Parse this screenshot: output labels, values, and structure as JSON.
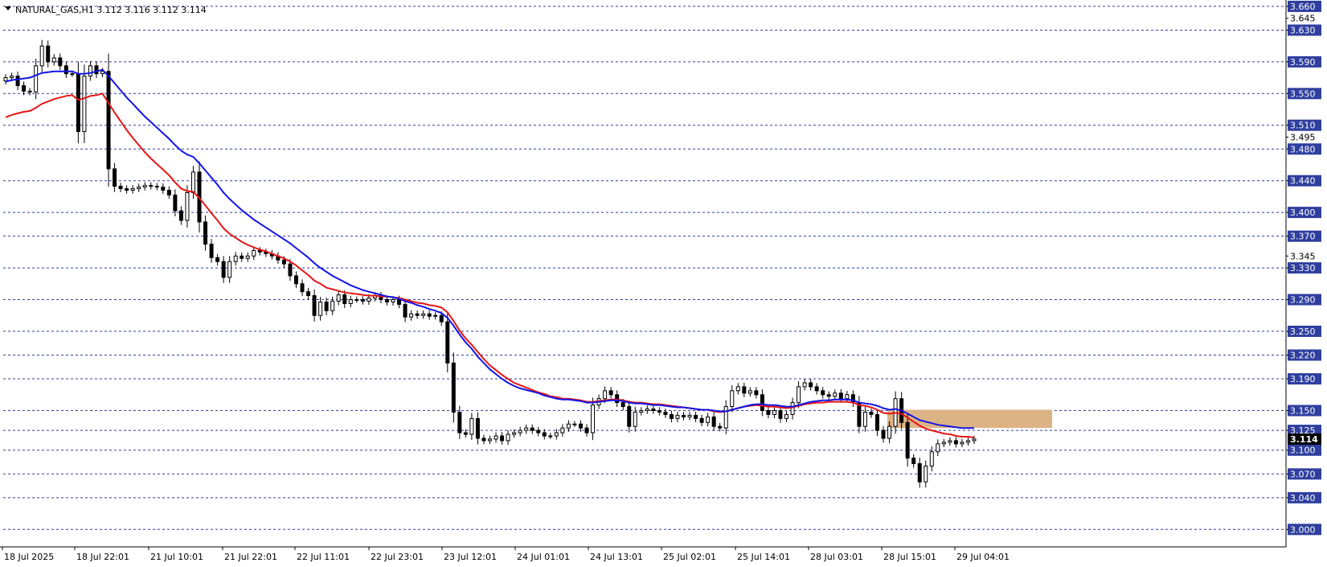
{
  "chart_data": {
    "type": "candlestick",
    "title": "NATURAL_GAS,H1  3.112 3.116 3.112 3.114",
    "y_range": [
      2.98,
      3.666
    ],
    "y_ticks": [
      "3.660",
      "3.645",
      "3.630",
      "3.590",
      "3.550",
      "3.510",
      "3.495",
      "3.480",
      "3.440",
      "3.400",
      "3.370",
      "3.345",
      "3.330",
      "3.290",
      "3.250",
      "3.220",
      "3.190",
      "3.150",
      "3.125",
      "3.100",
      "3.070",
      "3.040",
      "3.000"
    ],
    "level_lines": [
      3.66,
      3.63,
      3.59,
      3.55,
      3.51,
      3.48,
      3.44,
      3.4,
      3.37,
      3.33,
      3.29,
      3.25,
      3.22,
      3.19,
      3.15,
      3.125,
      3.1,
      3.07,
      3.04,
      3.0
    ],
    "current_price": "3.114",
    "x_ticks": [
      "18 Jul 2025",
      "18 Jul 22:01",
      "21 Jul 10:01",
      "21 Jul 22:01",
      "22 Jul 11:01",
      "22 Jul 23:01",
      "23 Jul 12:01",
      "24 Jul 01:01",
      "24 Jul 13:01",
      "25 Jul 02:01",
      "25 Jul 14:01",
      "28 Jul 03:01",
      "28 Jul 15:01",
      "29 Jul 04:01"
    ],
    "zone": {
      "from": 3.128,
      "to": 3.151,
      "color": "#dcb385"
    },
    "colors": {
      "grid": "#2f3f9f",
      "label_bg": "#2f3f9f",
      "ma_fast": "#1515e6",
      "ma_slow": "#e61515",
      "candle": "#000000",
      "bull_fill": "#ffffff",
      "bear_fill": "#000000"
    },
    "close": [
      3.57,
      3.572,
      3.56,
      3.553,
      3.552,
      3.585,
      3.61,
      3.59,
      3.595,
      3.585,
      3.575,
      3.575,
      3.502,
      3.572,
      3.585,
      3.575,
      3.578,
      3.455,
      3.433,
      3.43,
      3.428,
      3.43,
      3.432,
      3.434,
      3.433,
      3.432,
      3.428,
      3.422,
      3.402,
      3.39,
      3.425,
      3.451,
      3.388,
      3.36,
      3.343,
      3.338,
      3.318,
      3.338,
      3.345,
      3.342,
      3.345,
      3.352,
      3.35,
      3.348,
      3.345,
      3.34,
      3.335,
      3.32,
      3.31,
      3.3,
      3.295,
      3.27,
      3.287,
      3.276,
      3.288,
      3.296,
      3.285,
      3.29,
      3.29,
      3.288,
      3.292,
      3.295,
      3.29,
      3.287,
      3.29,
      3.284,
      3.268,
      3.272,
      3.27,
      3.272,
      3.269,
      3.27,
      3.262,
      3.21,
      3.148,
      3.122,
      3.12,
      3.14,
      3.115,
      3.112,
      3.114,
      3.118,
      3.112,
      3.12,
      3.122,
      3.125,
      3.128,
      3.125,
      3.122,
      3.118,
      3.118,
      3.122,
      3.128,
      3.133,
      3.133,
      3.128,
      3.122,
      3.157,
      3.165,
      3.175,
      3.17,
      3.16,
      3.155,
      3.13,
      3.148,
      3.15,
      3.152,
      3.15,
      3.148,
      3.145,
      3.14,
      3.144,
      3.142,
      3.144,
      3.14,
      3.135,
      3.142,
      3.13,
      3.128,
      3.155,
      3.175,
      3.18,
      3.172,
      3.175,
      3.17,
      3.15,
      3.145,
      3.15,
      3.14,
      3.145,
      3.16,
      3.18,
      3.185,
      3.18,
      3.175,
      3.17,
      3.168,
      3.172,
      3.165,
      3.17,
      3.16,
      3.13,
      3.148,
      3.145,
      3.125,
      3.115,
      3.13,
      3.165,
      3.135,
      3.09,
      3.083,
      3.06,
      3.08,
      3.098,
      3.108,
      3.11,
      3.112,
      3.108,
      3.11,
      3.112,
      3.114
    ],
    "ma_fast": [
      3.565,
      3.567,
      3.568,
      3.569,
      3.57,
      3.573,
      3.576,
      3.577,
      3.578,
      3.578,
      3.578,
      3.578,
      3.575,
      3.575,
      3.576,
      3.578,
      3.58,
      3.572,
      3.563,
      3.554,
      3.545,
      3.537,
      3.529,
      3.521,
      3.514,
      3.507,
      3.5,
      3.493,
      3.485,
      3.478,
      3.473,
      3.47,
      3.462,
      3.453,
      3.444,
      3.435,
      3.425,
      3.417,
      3.41,
      3.403,
      3.397,
      3.391,
      3.386,
      3.381,
      3.376,
      3.371,
      3.366,
      3.361,
      3.355,
      3.349,
      3.343,
      3.336,
      3.33,
      3.325,
      3.32,
      3.316,
      3.312,
      3.308,
      3.305,
      3.302,
      3.3,
      3.298,
      3.296,
      3.294,
      3.293,
      3.291,
      3.288,
      3.286,
      3.283,
      3.281,
      3.278,
      3.276,
      3.273,
      3.267,
      3.257,
      3.246,
      3.236,
      3.228,
      3.218,
      3.21,
      3.202,
      3.196,
      3.19,
      3.185,
      3.181,
      3.178,
      3.176,
      3.174,
      3.172,
      3.169,
      3.167,
      3.165,
      3.164,
      3.164,
      3.163,
      3.162,
      3.16,
      3.16,
      3.161,
      3.162,
      3.163,
      3.163,
      3.162,
      3.16,
      3.159,
      3.159,
      3.158,
      3.157,
      3.157,
      3.156,
      3.155,
      3.154,
      3.154,
      3.153,
      3.152,
      3.151,
      3.151,
      3.15,
      3.149,
      3.149,
      3.151,
      3.153,
      3.155,
      3.157,
      3.158,
      3.158,
      3.157,
      3.157,
      3.156,
      3.155,
      3.155,
      3.157,
      3.159,
      3.161,
      3.162,
      3.163,
      3.163,
      3.164,
      3.164,
      3.164,
      3.163,
      3.16,
      3.159,
      3.158,
      3.156,
      3.153,
      3.151,
      3.152,
      3.15,
      3.146,
      3.142,
      3.138,
      3.136,
      3.134,
      3.132,
      3.131,
      3.13,
      3.129,
      3.128,
      3.128,
      3.128
    ],
    "ma_slow": [
      3.52,
      3.523,
      3.525,
      3.527,
      3.528,
      3.532,
      3.537,
      3.54,
      3.543,
      3.545,
      3.547,
      3.548,
      3.542,
      3.544,
      3.547,
      3.548,
      3.55,
      3.538,
      3.526,
      3.515,
      3.504,
      3.494,
      3.485,
      3.476,
      3.468,
      3.461,
      3.454,
      3.447,
      3.438,
      3.43,
      3.427,
      3.426,
      3.418,
      3.409,
      3.399,
      3.39,
      3.38,
      3.373,
      3.368,
      3.363,
      3.359,
      3.356,
      3.353,
      3.351,
      3.348,
      3.345,
      3.342,
      3.338,
      3.333,
      3.327,
      3.321,
      3.314,
      3.31,
      3.305,
      3.303,
      3.301,
      3.299,
      3.298,
      3.297,
      3.296,
      3.295,
      3.295,
      3.294,
      3.294,
      3.293,
      3.292,
      3.29,
      3.288,
      3.286,
      3.285,
      3.283,
      3.282,
      3.28,
      3.274,
      3.263,
      3.251,
      3.241,
      3.233,
      3.224,
      3.215,
      3.207,
      3.201,
      3.195,
      3.19,
      3.185,
      3.182,
      3.179,
      3.176,
      3.173,
      3.171,
      3.168,
      3.167,
      3.165,
      3.165,
      3.164,
      3.163,
      3.161,
      3.161,
      3.162,
      3.163,
      3.164,
      3.164,
      3.163,
      3.161,
      3.16,
      3.16,
      3.159,
      3.158,
      3.158,
      3.157,
      3.156,
      3.155,
      3.154,
      3.153,
      3.152,
      3.151,
      3.151,
      3.149,
      3.148,
      3.149,
      3.151,
      3.153,
      3.155,
      3.156,
      3.157,
      3.156,
      3.155,
      3.155,
      3.154,
      3.153,
      3.154,
      3.156,
      3.158,
      3.159,
      3.16,
      3.16,
      3.161,
      3.161,
      3.161,
      3.161,
      3.16,
      3.157,
      3.156,
      3.154,
      3.151,
      3.147,
      3.146,
      3.147,
      3.146,
      3.141,
      3.136,
      3.131,
      3.127,
      3.125,
      3.123,
      3.121,
      3.12,
      3.118,
      3.117,
      3.117,
      3.116
    ]
  }
}
